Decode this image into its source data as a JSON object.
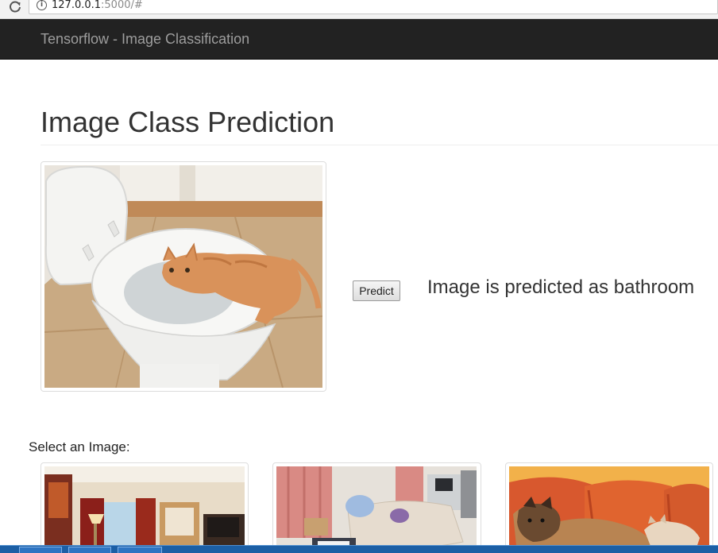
{
  "browser": {
    "url_host": "127.0.0.1",
    "url_rest": ":5000/#",
    "icons": [
      "reload-icon",
      "info-icon"
    ]
  },
  "navbar": {
    "brand": "Tensorflow - Image Classification"
  },
  "main": {
    "title": "Image Class Prediction",
    "predict_label": "Predict",
    "prediction_text": "Image is predicted as bathroom"
  },
  "gallery": {
    "label": "Select an Image:",
    "images": [
      "hotel-room",
      "living-room",
      "dog-and-cat-on-couch"
    ]
  },
  "colors": {
    "navbar_bg": "#222222",
    "brand_text": "#9d9d9d",
    "taskbar": "#1c5fa5"
  }
}
